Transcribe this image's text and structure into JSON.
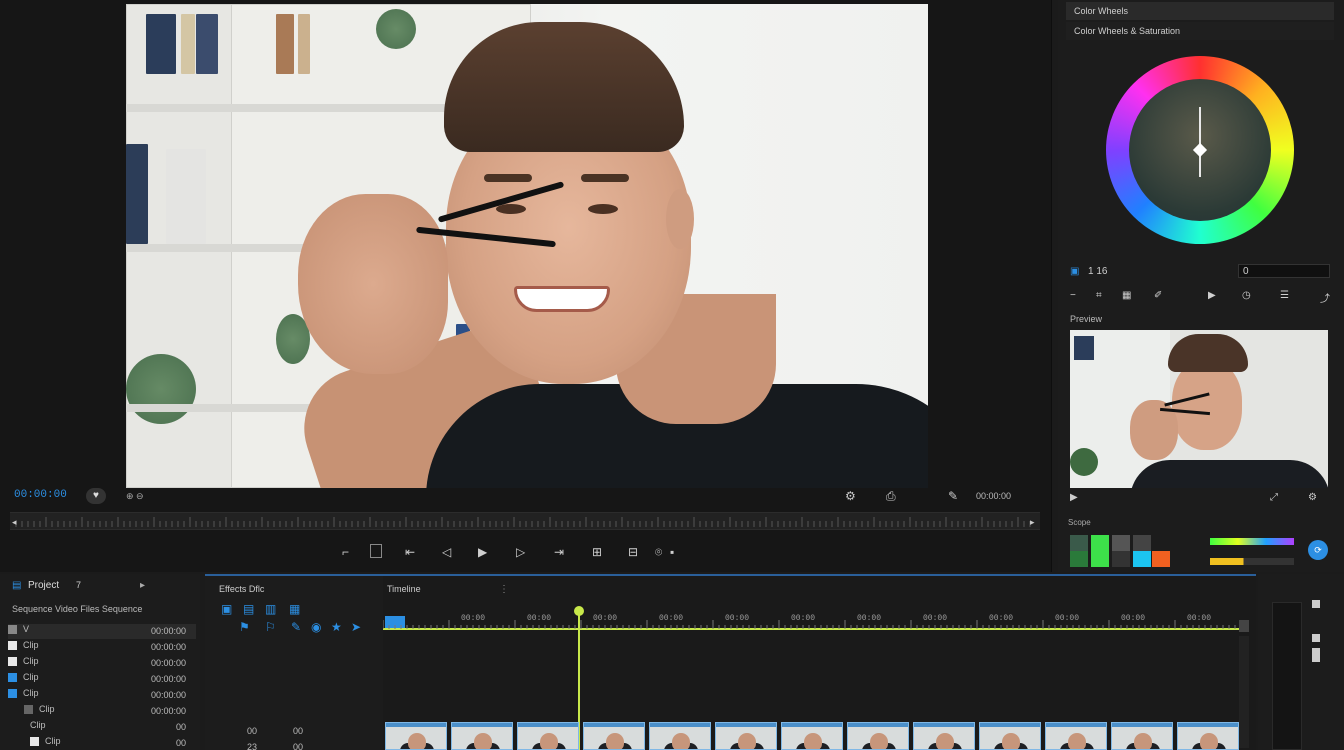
{
  "program_monitor": {
    "timecode": "00:00:00",
    "zoom_label": "⊕ ⊖",
    "fit_label": "00:00:00"
  },
  "right_panel": {
    "header_title": "Color Wheels",
    "subheader": "Color Wheels & Saturation",
    "controls_row1_label": "1 16",
    "controls_row1_value": "0",
    "preview_label": "Preview",
    "scope_label": "Scope"
  },
  "project_panel": {
    "title": "Project",
    "count": "7",
    "subtitle": "Sequence Video Files Sequence",
    "rows": [
      {
        "name": "V",
        "value": "00:00:00"
      },
      {
        "name": "Clip",
        "value": "00:00:00"
      },
      {
        "name": "Clip",
        "value": "00:00:00"
      },
      {
        "name": "Clip",
        "value": "00:00:00"
      },
      {
        "name": "Clip",
        "value": "00:00:00"
      },
      {
        "name": "Clip",
        "value": "00:00:00"
      },
      {
        "name": "Clip",
        "value": "00"
      },
      {
        "name": "Clip",
        "value": "00"
      }
    ]
  },
  "effects_panel": {
    "title": "Effects Dflc",
    "values": [
      "00",
      "23",
      "00",
      "00"
    ]
  },
  "timeline": {
    "title": "Timeline",
    "tick_labels": [
      "00:00",
      "00:00",
      "00:00",
      "00:00",
      "00:00",
      "00:00",
      "00:00",
      "00:00",
      "00:00",
      "00:00",
      "00:00",
      "00:00"
    ],
    "clip_count": 13
  },
  "colors": {
    "accent": "#2c8fe3",
    "playhead": "#c8e84a",
    "timeline_border": "#2a5f9a"
  }
}
